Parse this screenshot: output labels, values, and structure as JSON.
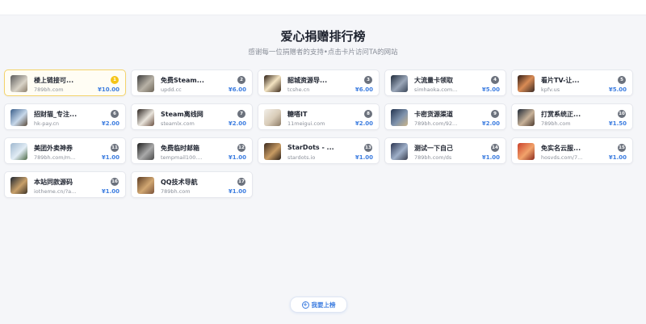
{
  "header": {
    "title": "爱心捐赠排行榜",
    "subtitle": "感谢每一位捐赠者的支持•点击卡片访问TA的网站"
  },
  "cards": [
    {
      "rank": "1",
      "name": "楼上链接可...",
      "domain": "789bh.com",
      "price": "¥10.00",
      "icon": "site-thumbnail-icon"
    },
    {
      "rank": "2",
      "name": "免费Steam...",
      "domain": "updd.cc",
      "price": "¥6.00",
      "icon": "site-thumbnail-icon"
    },
    {
      "rank": "3",
      "name": "韶城资源导...",
      "domain": "tcshe.cn",
      "price": "¥6.00",
      "icon": "site-thumbnail-icon"
    },
    {
      "rank": "4",
      "name": "大流量卡领取",
      "domain": "simhaoka.com...",
      "price": "¥5.00",
      "icon": "site-thumbnail-icon"
    },
    {
      "rank": "5",
      "name": "看片TV-让...",
      "domain": "kpfv.us",
      "price": "¥5.00",
      "icon": "site-thumbnail-icon"
    },
    {
      "rank": "6",
      "name": "招财猫_专注...",
      "domain": "hk-pay.cn",
      "price": "¥2.00",
      "icon": "site-thumbnail-icon"
    },
    {
      "rank": "7",
      "name": "Steam离线网",
      "domain": "steamlx.com",
      "price": "¥2.00",
      "icon": "site-thumbnail-icon"
    },
    {
      "rank": "8",
      "name": "糖嗒IT",
      "domain": "11meigui.com",
      "price": "¥2.00",
      "icon": "site-thumbnail-icon"
    },
    {
      "rank": "9",
      "name": "卡密货源渠道",
      "domain": "789bh.com/92...",
      "price": "¥2.00",
      "icon": "site-thumbnail-icon"
    },
    {
      "rank": "10",
      "name": "打赏系统正...",
      "domain": "789bh.com",
      "price": "¥1.50",
      "icon": "site-thumbnail-icon"
    },
    {
      "rank": "11",
      "name": "美团外卖神券",
      "domain": "789bh.com/m...",
      "price": "¥1.00",
      "icon": "site-thumbnail-icon"
    },
    {
      "rank": "12",
      "name": "免费临时邮箱",
      "domain": "tempmail100....",
      "price": "¥1.00",
      "icon": "site-thumbnail-icon"
    },
    {
      "rank": "13",
      "name": "StarDots - ...",
      "domain": "stardots.io",
      "price": "¥1.00",
      "icon": "site-thumbnail-icon"
    },
    {
      "rank": "14",
      "name": "测试一下自己",
      "domain": "789bh.com/ds",
      "price": "¥1.00",
      "icon": "site-thumbnail-icon"
    },
    {
      "rank": "15",
      "name": "免实名云服...",
      "domain": "hosvds.com/7...",
      "price": "¥1.00",
      "icon": "site-thumbnail-icon"
    },
    {
      "rank": "16",
      "name": "本站同款源码",
      "domain": "iotheme.cn/?a...",
      "price": "¥1.00",
      "icon": "site-thumbnail-icon"
    },
    {
      "rank": "17",
      "name": "QQ技术导航",
      "domain": "789bh.com",
      "price": "¥1.00",
      "icon": "site-thumbnail-icon"
    }
  ],
  "apply_button": {
    "label": "我要上榜",
    "icon": "plus-circle-icon"
  },
  "colors": {
    "accent": "#3d7de0",
    "gold": "#f5c518",
    "rank_badge": "#6b717c"
  }
}
